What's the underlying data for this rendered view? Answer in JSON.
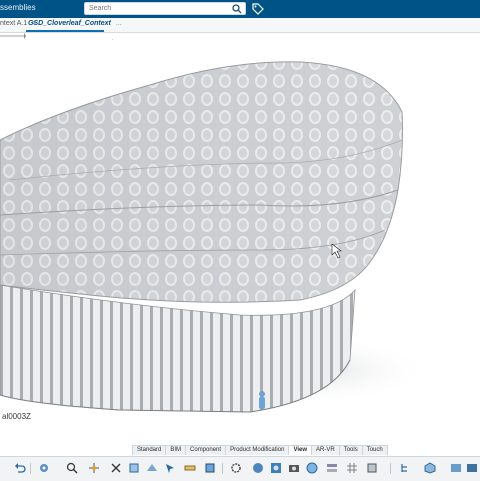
{
  "header": {
    "app_crumb": "ssemblies",
    "search_placeholder": "Search",
    "accent": "#005386"
  },
  "tabs": [
    {
      "label": "ntext A.1"
    },
    {
      "label": "GSD_Cloverleaf_Context",
      "suffix": "..."
    }
  ],
  "viewport": {
    "part_label": "al0003Z"
  },
  "workbench_tabs": [
    "Standard",
    "BIM",
    "Component",
    "Product Modification",
    "View",
    "AR-VR",
    "Tools",
    "Touch"
  ],
  "active_workbench": "View",
  "toolbar_icons": [
    "undo-icon",
    "pan-icon",
    "rotate-icon",
    "zoom-icon",
    "fit-all-icon",
    "normal-view-icon",
    "hide-show-icon",
    "select-icon",
    "measure-icon",
    "section-icon",
    "render-icon",
    "shading-icon",
    "camera-icon",
    "globe-icon",
    "layers-icon",
    "grid-icon",
    "compass-icon",
    "tree-icon",
    "cube-icon",
    "settings-icon"
  ]
}
